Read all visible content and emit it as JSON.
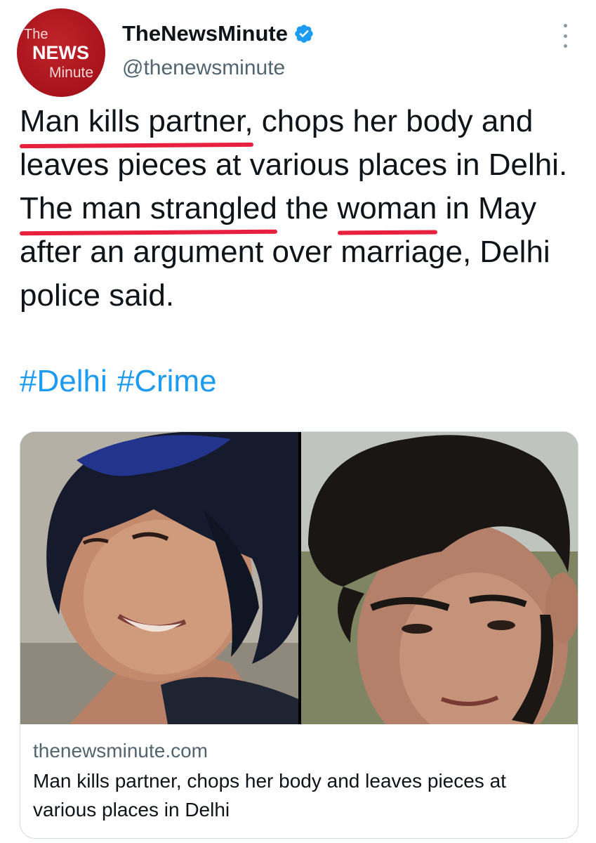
{
  "author": {
    "display_name": "TheNewsMinute",
    "handle": "@thenewsminute",
    "avatar_text": {
      "line1": "The",
      "line2": "NEWS",
      "line3": "Minute"
    },
    "brand_color": "#b0141d",
    "verified": true
  },
  "tweet": {
    "text_parts": [
      "Man kills partner,",
      " chops her body and leaves pieces at various places in Delhi. ",
      "The man strangled",
      " the ",
      "woman",
      " in May after an argument over marriage, Delhi police said."
    ],
    "hashtags": [
      "#Delhi",
      "#Crime"
    ],
    "underline_color": "#e8203f",
    "link_color": "#1d9bf0"
  },
  "card": {
    "images": [
      "young woman with blue-tinted hair smiling",
      "young man with dark curly hair"
    ],
    "domain": "thenewsminute.com",
    "title": "Man kills partner, chops her body and leaves pieces at various places in Delhi"
  },
  "icons": {
    "verified": "verified-badge-icon",
    "more": "more-options-icon"
  }
}
